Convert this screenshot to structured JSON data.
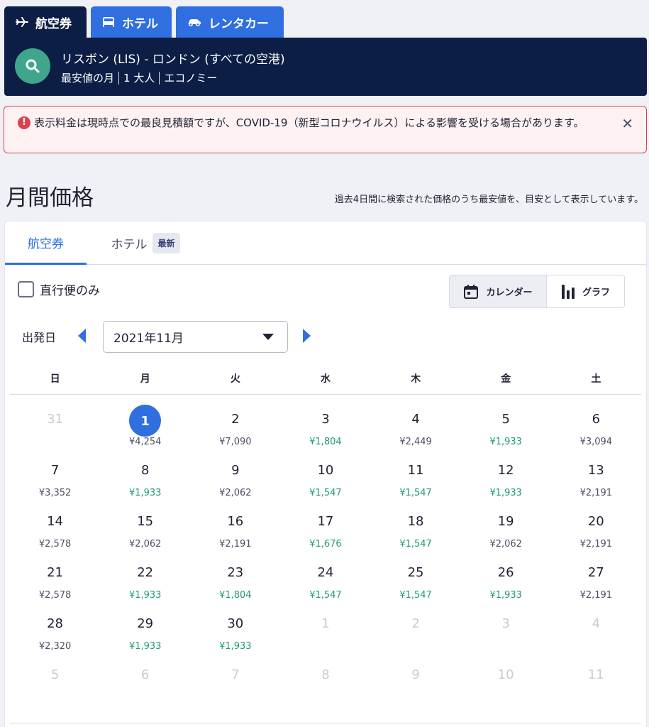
{
  "top_tabs": [
    {
      "label": "航空券",
      "icon": "plane-icon",
      "active": true
    },
    {
      "label": "ホテル",
      "icon": "bed-icon",
      "active": false
    },
    {
      "label": "レンタカー",
      "icon": "car-icon",
      "active": false
    }
  ],
  "search": {
    "route": "リスボン (LIS) - ロンドン (すべての空港)",
    "details": [
      "最安値の月",
      "1 大人",
      "エコノミー"
    ]
  },
  "alert": {
    "text": "表示料金は現時点での最良見積額ですが、COVID-19（新型コロナウイルス）による影響を受ける場合があります。"
  },
  "page": {
    "title": "月間価格",
    "note": "過去4日間に検索された価格のうち最安値を、目安として表示しています。"
  },
  "card": {
    "tabs": {
      "flights": "航空券",
      "hotels": "ホテル",
      "new_badge": "最新"
    },
    "direct_only_label": "直行便のみ",
    "view": {
      "calendar": "カレンダー",
      "graph": "グラフ"
    },
    "depart_label": "出発日",
    "month": "2021年11月"
  },
  "calendar": {
    "weekdays": [
      "日",
      "月",
      "火",
      "水",
      "木",
      "金",
      "土"
    ],
    "weeks": [
      [
        {
          "d": "31",
          "p": "",
          "dim": true
        },
        {
          "d": "1",
          "p": "¥4,254",
          "sel": true
        },
        {
          "d": "2",
          "p": "¥7,090"
        },
        {
          "d": "3",
          "p": "¥1,804",
          "low": true
        },
        {
          "d": "4",
          "p": "¥2,449"
        },
        {
          "d": "5",
          "p": "¥1,933",
          "low": true
        },
        {
          "d": "6",
          "p": "¥3,094"
        }
      ],
      [
        {
          "d": "7",
          "p": "¥3,352"
        },
        {
          "d": "8",
          "p": "¥1,933",
          "low": true
        },
        {
          "d": "9",
          "p": "¥2,062"
        },
        {
          "d": "10",
          "p": "¥1,547",
          "low": true
        },
        {
          "d": "11",
          "p": "¥1,547",
          "low": true
        },
        {
          "d": "12",
          "p": "¥1,933",
          "low": true
        },
        {
          "d": "13",
          "p": "¥2,191"
        }
      ],
      [
        {
          "d": "14",
          "p": "¥2,578"
        },
        {
          "d": "15",
          "p": "¥2,062"
        },
        {
          "d": "16",
          "p": "¥2,191"
        },
        {
          "d": "17",
          "p": "¥1,676",
          "low": true
        },
        {
          "d": "18",
          "p": "¥1,547",
          "low": true
        },
        {
          "d": "19",
          "p": "¥2,062"
        },
        {
          "d": "20",
          "p": "¥2,191"
        }
      ],
      [
        {
          "d": "21",
          "p": "¥2,578"
        },
        {
          "d": "22",
          "p": "¥1,933",
          "low": true
        },
        {
          "d": "23",
          "p": "¥1,804",
          "low": true
        },
        {
          "d": "24",
          "p": "¥1,547",
          "low": true
        },
        {
          "d": "25",
          "p": "¥1,547",
          "low": true
        },
        {
          "d": "26",
          "p": "¥1,933",
          "low": true
        },
        {
          "d": "27",
          "p": "¥2,191"
        }
      ],
      [
        {
          "d": "28",
          "p": "¥2,320"
        },
        {
          "d": "29",
          "p": "¥1,933",
          "low": true
        },
        {
          "d": "30",
          "p": "¥1,933",
          "low": true
        },
        {
          "d": "1",
          "p": "",
          "dim": true
        },
        {
          "d": "2",
          "p": "",
          "dim": true
        },
        {
          "d": "3",
          "p": "",
          "dim": true
        },
        {
          "d": "4",
          "p": "",
          "dim": true
        }
      ],
      [
        {
          "d": "5",
          "p": "",
          "dim": true
        },
        {
          "d": "6",
          "p": "",
          "dim": true
        },
        {
          "d": "7",
          "p": "",
          "dim": true
        },
        {
          "d": "8",
          "p": "",
          "dim": true
        },
        {
          "d": "9",
          "p": "",
          "dim": true
        },
        {
          "d": "10",
          "p": "",
          "dim": true
        },
        {
          "d": "11",
          "p": "",
          "dim": true
        }
      ]
    ]
  },
  "colors": {
    "navy": "#0c1e45",
    "blue": "#2f6fdf",
    "green": "#1c9a72",
    "teal": "#3fa68c",
    "alert_red": "#d9434f"
  }
}
